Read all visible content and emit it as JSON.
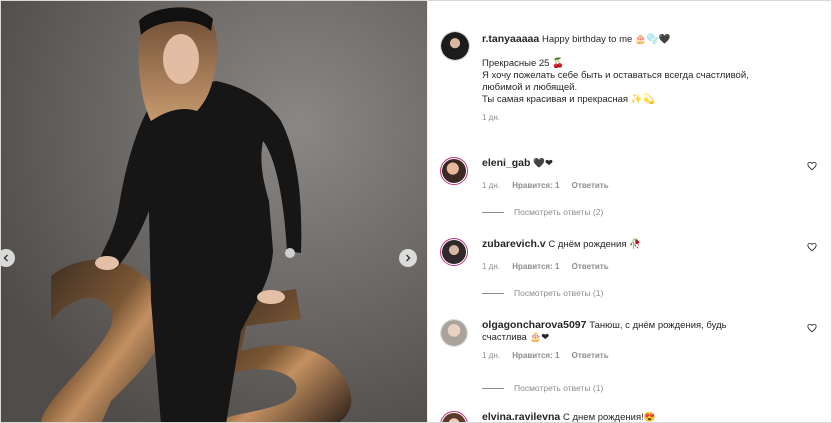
{
  "post": {
    "author": "r.tanyaaaaa",
    "caption_first": "Happy birthday to me 🎂🫧🖤",
    "caption_lines": [
      "Прекрасные 25 🍒",
      "Я хочу пожелать себе быть и оставаться всегда счастливой,",
      "любимой и любящей.",
      "Ты самая красивая и прекрасная ✨💫"
    ],
    "time": "1 дн."
  },
  "comments": [
    {
      "user": "eleni_gab",
      "text": "🖤❤",
      "time": "1 дн.",
      "likes": "Нравится: 1",
      "reply": "Ответить",
      "view_replies": "Посмотреть ответы (2)"
    },
    {
      "user": "zubarevich.v",
      "text": "С днём рождения 🥀",
      "time": "1 дн.",
      "likes": "Нравится: 1",
      "reply": "Ответить",
      "view_replies": "Посмотреть ответы (1)"
    },
    {
      "user": "olgagoncharova5097",
      "text_line1": "Танюш, с днём рождения, будь",
      "text_line2": "счастлива 🎂❤",
      "time": "1 дн.",
      "likes": "Нравится: 1",
      "reply": "Ответить",
      "view_replies": "Посмотреть ответы (1)"
    },
    {
      "user": "elvina.ravilevna",
      "text": "С днем рождения!😍"
    }
  ],
  "icons": {
    "prev": "chevron-left-icon",
    "next": "chevron-right-icon",
    "like": "heart-outline-icon"
  },
  "colors": {
    "background_photo": "#6e6b69",
    "muted_text": "#8e8e8e",
    "story_ring": "#c13584"
  }
}
